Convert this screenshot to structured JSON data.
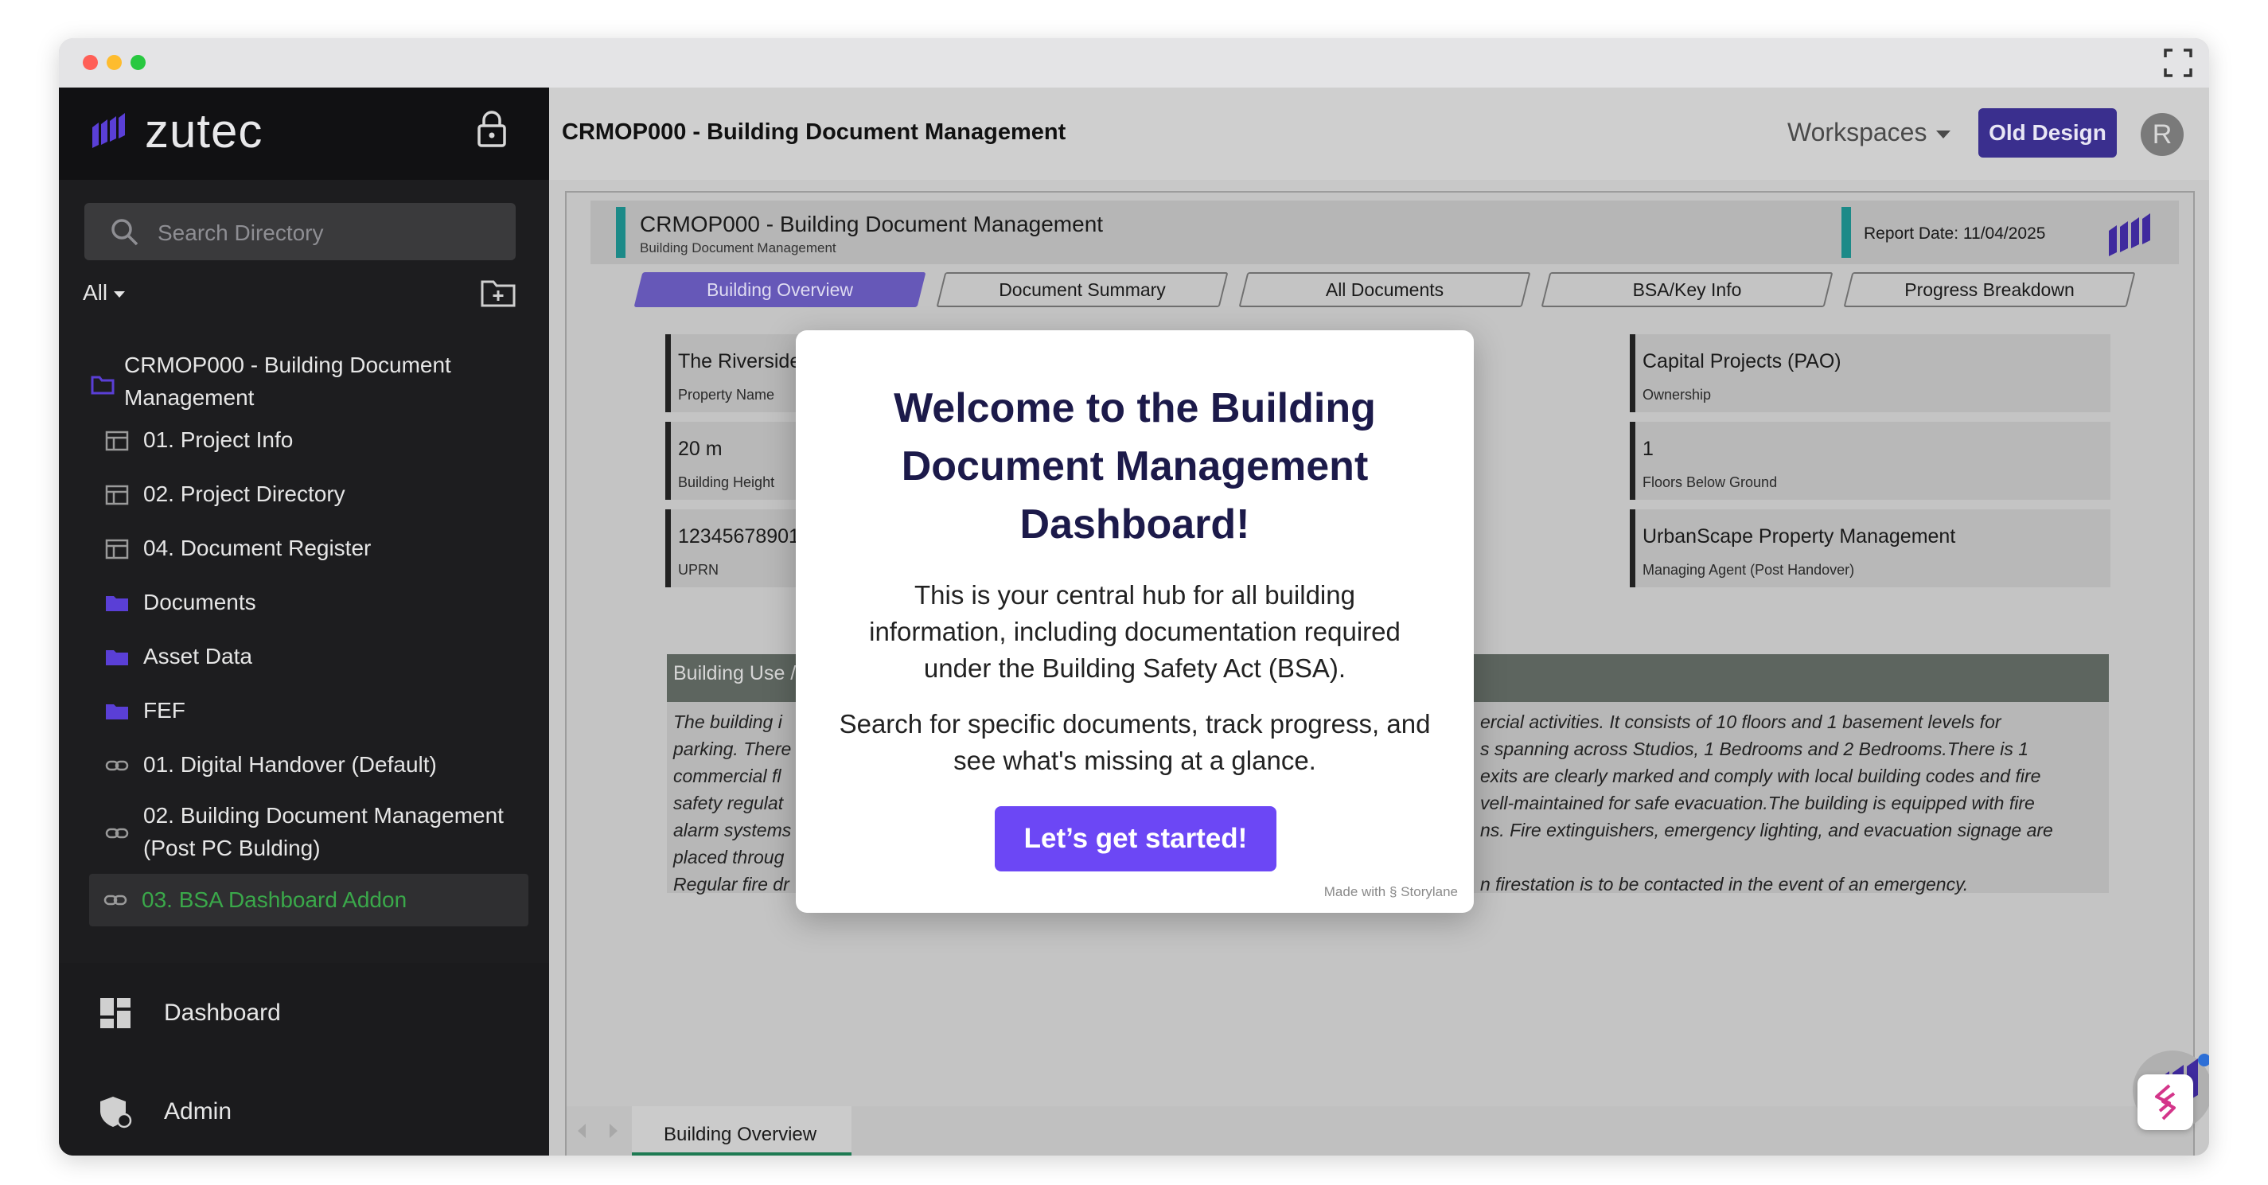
{
  "sidebar": {
    "brand": "zutec",
    "search_placeholder": "Search Directory",
    "filter_label": "All",
    "tree": [
      {
        "label": "CRMOP000 - Building Document Management",
        "icon": "folder-outline-icon"
      },
      {
        "label": "01. Project Info",
        "icon": "table-icon"
      },
      {
        "label": "02. Project Directory",
        "icon": "table-icon"
      },
      {
        "label": "04. Document Register",
        "icon": "table-icon"
      },
      {
        "label": "Documents",
        "icon": "folder-icon"
      },
      {
        "label": "Asset Data",
        "icon": "folder-icon"
      },
      {
        "label": "FEF",
        "icon": "folder-icon"
      },
      {
        "label": "01. Digital Handover (Default)",
        "icon": "link-icon"
      },
      {
        "label": "02. Building Document Management (Post PC Bulding)",
        "icon": "link-icon"
      },
      {
        "label": "03. BSA Dashboard Addon",
        "icon": "link-icon",
        "active": true
      }
    ],
    "nav": {
      "dashboard": "Dashboard",
      "admin": "Admin"
    }
  },
  "header": {
    "title": "CRMOP000 - Building Document Management",
    "workspaces": "Workspaces",
    "old_design": "Old Design",
    "avatar_initial": "R"
  },
  "report": {
    "title": "CRMOP000 - Building Document Management",
    "subtitle": "Building Document Management",
    "report_date": "Report Date: 11/04/2025",
    "tabs": [
      "Building Overview",
      "Document Summary",
      "All Documents",
      "BSA/Key Info",
      "Progress Breakdown"
    ],
    "cards_left": [
      {
        "value": "The Riverside",
        "caption": "Property Name"
      },
      {
        "value": "20 m",
        "caption": "Building Height"
      },
      {
        "value": "12345678901",
        "caption": "UPRN"
      }
    ],
    "cards_right": [
      {
        "value": "Capital Projects (PAO)",
        "caption": "Ownership"
      },
      {
        "value": "1",
        "caption": "Floors Below Ground"
      },
      {
        "value": "UrbanScape Property Management",
        "caption": "Managing Agent (Post Handover)"
      }
    ],
    "building_use_label": "Building Use /",
    "building_use_left": [
      "The building i",
      "parking. There",
      "commercial fl",
      "safety regulat",
      "alarm systems",
      "placed throug",
      "Regular fire dr"
    ],
    "building_use_right": [
      "ercial activities. It consists of 10 floors and 1 basement levels for",
      "s spanning across Studios, 1 Bedrooms and 2 Bedrooms.There is 1",
      "exits are clearly marked and comply with local building codes and fire",
      "vell-maintained for safe evacuation.The building is equipped with fire",
      "ns. Fire extinguishers, emergency lighting, and evacuation signage are",
      "",
      "n firestation is to be contacted in the event of an emergency."
    ],
    "bottom_tab": "Building Overview"
  },
  "modal": {
    "title": "Welcome to the Building Document Management Dashboard!",
    "p1": "This is your central hub for all building information, including documentation required under the Building Safety Act (BSA).",
    "p2": "Search for specific documents, track progress, and see what's missing at a glance.",
    "cta": "Let’s get started!",
    "made_with": "Made with",
    "storylane": "Storylane"
  },
  "colors": {
    "brand_purple": "#5a3fd6",
    "cta_purple": "#6c47f5",
    "teal_accent": "#1c8a88",
    "active_green": "#3aa84a"
  }
}
